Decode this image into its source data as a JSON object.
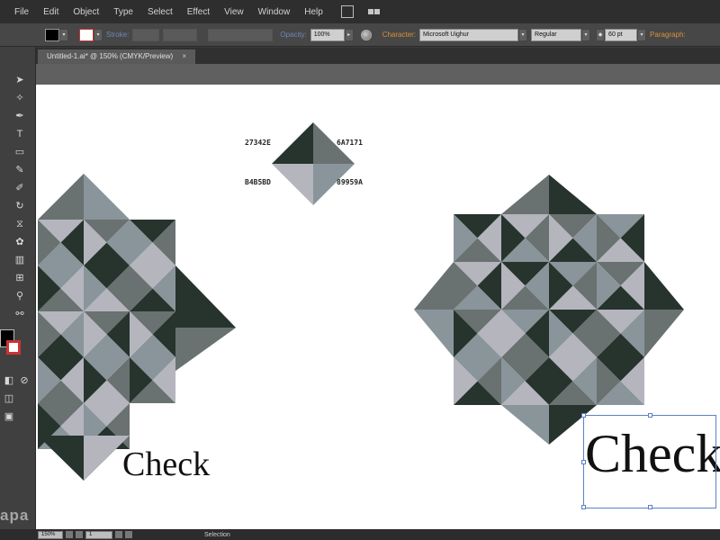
{
  "menubar": {
    "items": [
      "File",
      "Edit",
      "Object",
      "Type",
      "Select",
      "Effect",
      "View",
      "Window",
      "Help"
    ]
  },
  "control": {
    "stroke_label": "Stroke:",
    "opacity_label": "Opacity:",
    "opacity_value": "100%",
    "character_label": "Character:",
    "font_value": "Microsoft Uighur",
    "style_value": "Regular",
    "size_value": "60 pt",
    "paragraph_label": "Paragraph:",
    "fill_color": "#000000",
    "stroke_color": "#cc3333"
  },
  "document": {
    "tab_title": "Untitled-1.ai* @ 150% (CMYK/Preview)",
    "close_glyph": "×"
  },
  "colors": {
    "c1": "#27342E",
    "c2": "#6A7171",
    "c3": "#B4B5BD",
    "c4": "#89959A",
    "labels": {
      "tl": "27342E",
      "tr": "6A7171",
      "bl": "B4B5BD",
      "br": "89959A"
    }
  },
  "artwork": {
    "left_text": "Check",
    "right_text": "Check"
  },
  "statusbar": {
    "zoom": "150%",
    "page": "1",
    "tool": "Selection"
  },
  "watermark": "apa"
}
